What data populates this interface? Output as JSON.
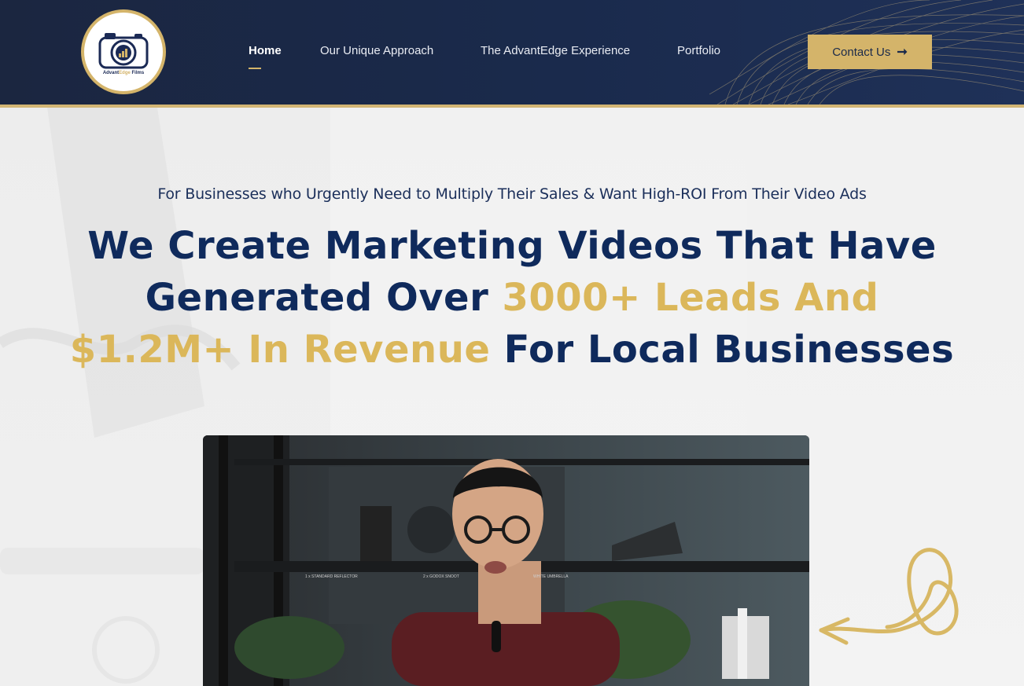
{
  "brand": {
    "logo_text_prefix": "Advant",
    "logo_text_edge": "Edge",
    "logo_text_suffix": " Films",
    "colors": {
      "navy": "#1b2640",
      "gold": "#d4b46a",
      "headline": "#0f2a5c"
    }
  },
  "nav": {
    "items": [
      {
        "label": "Home",
        "active": true
      },
      {
        "label": "Our Unique Approach",
        "active": false
      },
      {
        "label": "The AdvantEdge Experience",
        "active": false
      },
      {
        "label": "Portfolio",
        "active": false
      }
    ],
    "cta_label": "Contact Us",
    "cta_icon": "arrow-right-icon"
  },
  "hero": {
    "eyebrow": "For Businesses who Urgently Need to Multiply Their Sales & Want High-ROI From Their Video Ads",
    "headline_line1": "We Create Marketing Videos That Have",
    "headline_line2_a": "Generated Over ",
    "headline_line2_gold": "3000+ Leads And",
    "headline_line3_gold": "$1.2M+ In Revenue",
    "headline_line3_b": " For Local Businesses"
  },
  "video": {
    "shelf_labels": [
      "1 x STANDARD REFLECTOR",
      "2 x GODOX SNOOT",
      "WHITE UMBRELLA"
    ]
  }
}
